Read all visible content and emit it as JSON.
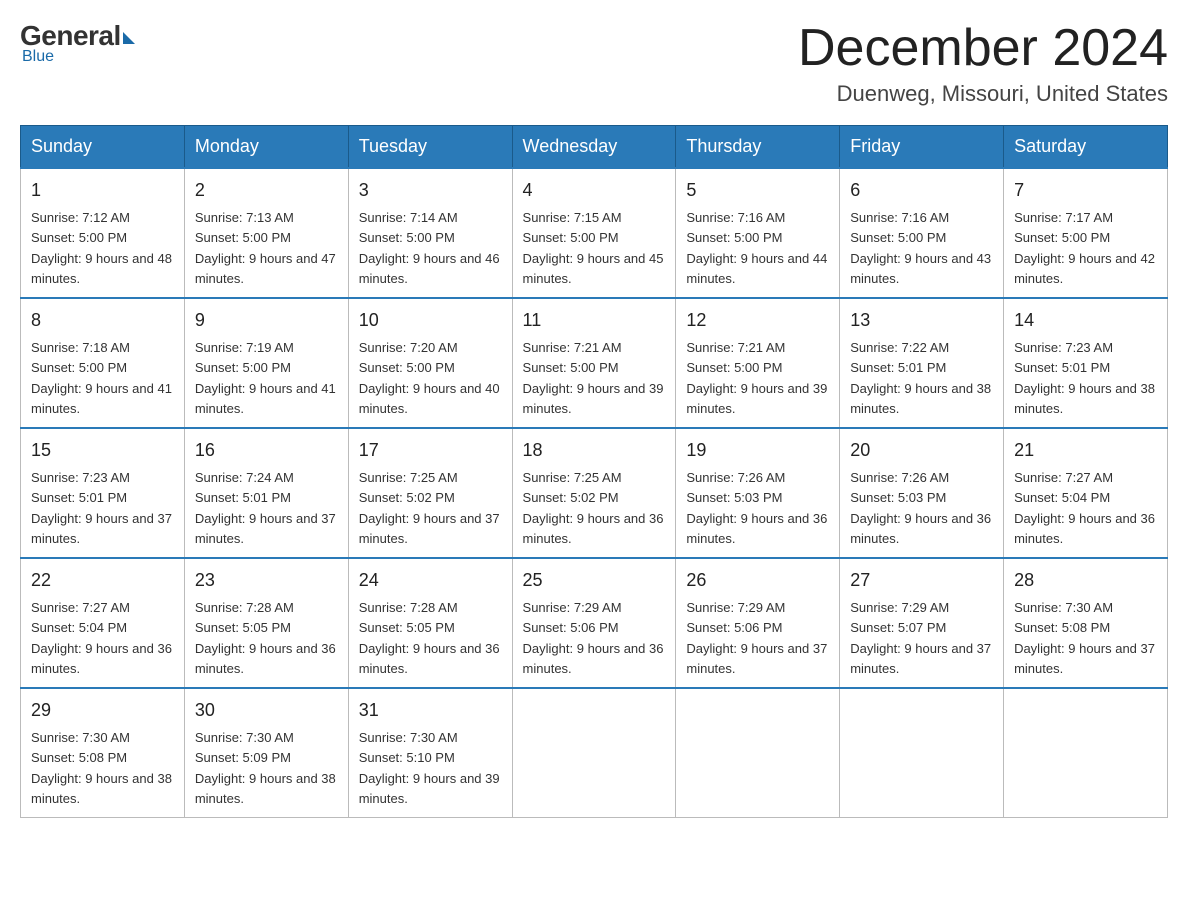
{
  "logo": {
    "general": "General",
    "blue": "Blue",
    "subtitle": "Blue"
  },
  "header": {
    "month_year": "December 2024",
    "location": "Duenweg, Missouri, United States"
  },
  "days_of_week": [
    "Sunday",
    "Monday",
    "Tuesday",
    "Wednesday",
    "Thursday",
    "Friday",
    "Saturday"
  ],
  "weeks": [
    [
      {
        "day": "1",
        "sunrise": "7:12 AM",
        "sunset": "5:00 PM",
        "daylight": "9 hours and 48 minutes."
      },
      {
        "day": "2",
        "sunrise": "7:13 AM",
        "sunset": "5:00 PM",
        "daylight": "9 hours and 47 minutes."
      },
      {
        "day": "3",
        "sunrise": "7:14 AM",
        "sunset": "5:00 PM",
        "daylight": "9 hours and 46 minutes."
      },
      {
        "day": "4",
        "sunrise": "7:15 AM",
        "sunset": "5:00 PM",
        "daylight": "9 hours and 45 minutes."
      },
      {
        "day": "5",
        "sunrise": "7:16 AM",
        "sunset": "5:00 PM",
        "daylight": "9 hours and 44 minutes."
      },
      {
        "day": "6",
        "sunrise": "7:16 AM",
        "sunset": "5:00 PM",
        "daylight": "9 hours and 43 minutes."
      },
      {
        "day": "7",
        "sunrise": "7:17 AM",
        "sunset": "5:00 PM",
        "daylight": "9 hours and 42 minutes."
      }
    ],
    [
      {
        "day": "8",
        "sunrise": "7:18 AM",
        "sunset": "5:00 PM",
        "daylight": "9 hours and 41 minutes."
      },
      {
        "day": "9",
        "sunrise": "7:19 AM",
        "sunset": "5:00 PM",
        "daylight": "9 hours and 41 minutes."
      },
      {
        "day": "10",
        "sunrise": "7:20 AM",
        "sunset": "5:00 PM",
        "daylight": "9 hours and 40 minutes."
      },
      {
        "day": "11",
        "sunrise": "7:21 AM",
        "sunset": "5:00 PM",
        "daylight": "9 hours and 39 minutes."
      },
      {
        "day": "12",
        "sunrise": "7:21 AM",
        "sunset": "5:00 PM",
        "daylight": "9 hours and 39 minutes."
      },
      {
        "day": "13",
        "sunrise": "7:22 AM",
        "sunset": "5:01 PM",
        "daylight": "9 hours and 38 minutes."
      },
      {
        "day": "14",
        "sunrise": "7:23 AM",
        "sunset": "5:01 PM",
        "daylight": "9 hours and 38 minutes."
      }
    ],
    [
      {
        "day": "15",
        "sunrise": "7:23 AM",
        "sunset": "5:01 PM",
        "daylight": "9 hours and 37 minutes."
      },
      {
        "day": "16",
        "sunrise": "7:24 AM",
        "sunset": "5:01 PM",
        "daylight": "9 hours and 37 minutes."
      },
      {
        "day": "17",
        "sunrise": "7:25 AM",
        "sunset": "5:02 PM",
        "daylight": "9 hours and 37 minutes."
      },
      {
        "day": "18",
        "sunrise": "7:25 AM",
        "sunset": "5:02 PM",
        "daylight": "9 hours and 36 minutes."
      },
      {
        "day": "19",
        "sunrise": "7:26 AM",
        "sunset": "5:03 PM",
        "daylight": "9 hours and 36 minutes."
      },
      {
        "day": "20",
        "sunrise": "7:26 AM",
        "sunset": "5:03 PM",
        "daylight": "9 hours and 36 minutes."
      },
      {
        "day": "21",
        "sunrise": "7:27 AM",
        "sunset": "5:04 PM",
        "daylight": "9 hours and 36 minutes."
      }
    ],
    [
      {
        "day": "22",
        "sunrise": "7:27 AM",
        "sunset": "5:04 PM",
        "daylight": "9 hours and 36 minutes."
      },
      {
        "day": "23",
        "sunrise": "7:28 AM",
        "sunset": "5:05 PM",
        "daylight": "9 hours and 36 minutes."
      },
      {
        "day": "24",
        "sunrise": "7:28 AM",
        "sunset": "5:05 PM",
        "daylight": "9 hours and 36 minutes."
      },
      {
        "day": "25",
        "sunrise": "7:29 AM",
        "sunset": "5:06 PM",
        "daylight": "9 hours and 36 minutes."
      },
      {
        "day": "26",
        "sunrise": "7:29 AM",
        "sunset": "5:06 PM",
        "daylight": "9 hours and 37 minutes."
      },
      {
        "day": "27",
        "sunrise": "7:29 AM",
        "sunset": "5:07 PM",
        "daylight": "9 hours and 37 minutes."
      },
      {
        "day": "28",
        "sunrise": "7:30 AM",
        "sunset": "5:08 PM",
        "daylight": "9 hours and 37 minutes."
      }
    ],
    [
      {
        "day": "29",
        "sunrise": "7:30 AM",
        "sunset": "5:08 PM",
        "daylight": "9 hours and 38 minutes."
      },
      {
        "day": "30",
        "sunrise": "7:30 AM",
        "sunset": "5:09 PM",
        "daylight": "9 hours and 38 minutes."
      },
      {
        "day": "31",
        "sunrise": "7:30 AM",
        "sunset": "5:10 PM",
        "daylight": "9 hours and 39 minutes."
      },
      null,
      null,
      null,
      null
    ]
  ]
}
